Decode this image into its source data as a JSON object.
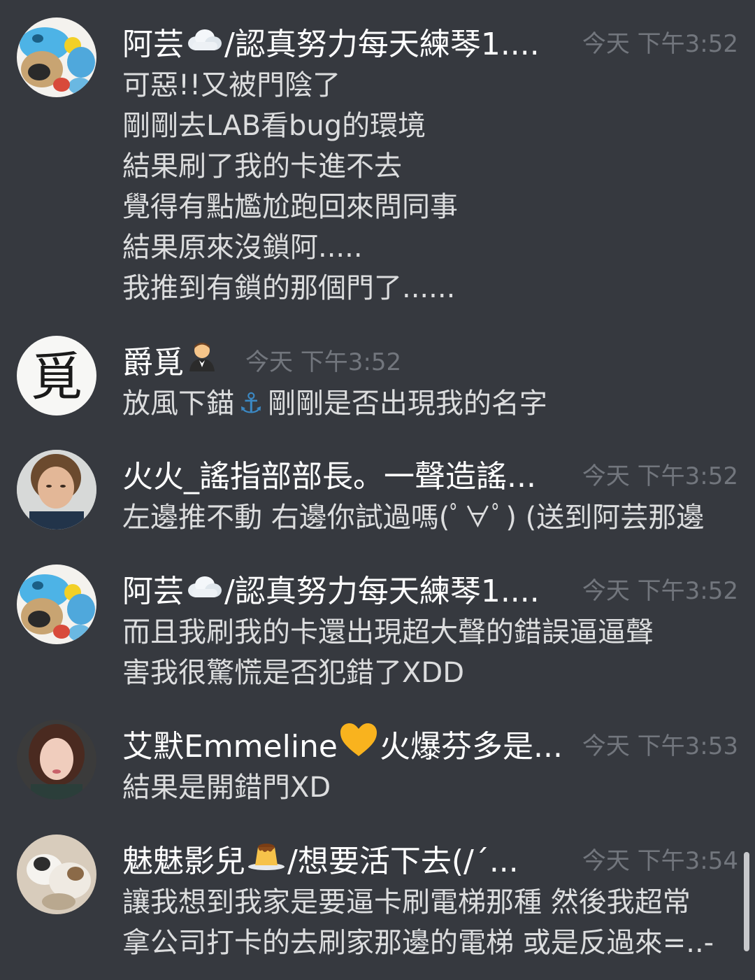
{
  "messages": [
    {
      "username": "阿芸",
      "username_suffix": "/認真努力每天練琴1....",
      "username_emoji": "cloud",
      "timestamp": "今天 下午3:52",
      "lines": [
        "可惡!!又被門陰了",
        "剛剛去LAB看bug的環境",
        "結果刷了我的卡進不去",
        "覺得有點尷尬跑回來問同事",
        "結果原來沒鎖阿.....",
        "我推到有鎖的那個門了......"
      ],
      "avatar": "blue-plush-avatar"
    },
    {
      "username": "爵覓",
      "username_emoji": "man-in-tuxedo",
      "timestamp": "今天 下午3:52",
      "line_before_emoji": "放風下錨",
      "line_emoji": "⚓",
      "line_after_emoji": "剛剛是否出現我的名字",
      "avatar_char": "覓"
    },
    {
      "username": "火火_謠指部部長。一聲造謠...",
      "timestamp": "今天 下午3:52",
      "lines": [
        "左邊推不動 右邊你試過嗎(ﾟ∀ﾟ) (送到阿芸那邊"
      ],
      "avatar": "woman-photo-avatar"
    },
    {
      "username": "阿芸",
      "username_suffix": "/認真努力每天練琴1....",
      "username_emoji": "cloud",
      "timestamp": "今天 下午3:52",
      "lines": [
        "而且我刷我的卡還出現超大聲的錯誤逼逼聲",
        "害我很驚慌是否犯錯了XDD"
      ],
      "avatar": "blue-plush-avatar"
    },
    {
      "username": "艾默Emmeline",
      "username_suffix": "火爆芬多是...",
      "username_emoji": "yellow-heart",
      "timestamp": "今天 下午3:53",
      "lines": [
        "結果是開錯門XD"
      ],
      "avatar": "girl-photo-avatar"
    },
    {
      "username": "魅魅影兒",
      "username_suffix": " /想要活下去(/´...",
      "username_emoji": "custard-pudding",
      "timestamp": "今天 下午3:54",
      "lines": [
        "讓我想到我家是要逼卡刷電梯那種  然後我超常",
        "拿公司打卡的去刷家那邊的電梯 或是反過來=..-"
      ],
      "avatar": "cats-photo-avatar"
    }
  ],
  "colors": {
    "background": "#36393f",
    "username": "#ffffff",
    "text": "#dcddde",
    "timestamp": "#72767d"
  }
}
